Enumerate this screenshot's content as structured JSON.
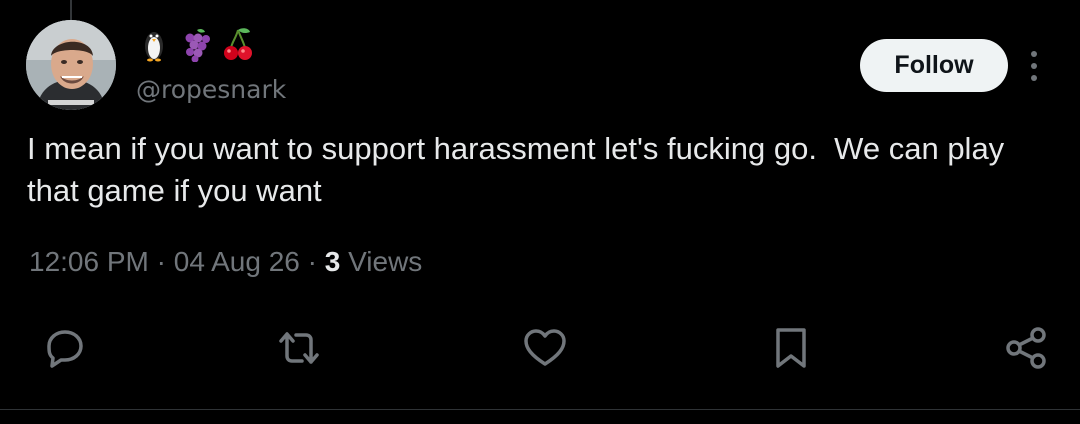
{
  "author": {
    "handle": "@ropesnark",
    "display_name_emojis": [
      "penguin-emoji",
      "grapes-emoji",
      "cherries-emoji"
    ],
    "avatar": "profile-photo"
  },
  "header": {
    "follow_label": "Follow",
    "more_icon": "more-vertical-icon"
  },
  "tweet": {
    "text": "I mean if you want to support harassment let's fucking go.  We can play that game if you want",
    "time": "12:06 PM",
    "separator": "·",
    "date": "04 Aug 26",
    "views_count": "3",
    "views_label": "Views"
  },
  "actions": [
    {
      "name": "reply",
      "icon": "reply-icon"
    },
    {
      "name": "repost",
      "icon": "repost-icon"
    },
    {
      "name": "like",
      "icon": "heart-icon"
    },
    {
      "name": "bookmark",
      "icon": "bookmark-icon"
    },
    {
      "name": "share",
      "icon": "share-icon"
    }
  ],
  "colors": {
    "background": "#000000",
    "text_primary": "#e7e9ea",
    "text_secondary": "#71767b",
    "follow_bg": "#eff3f4",
    "follow_text": "#0f1419"
  }
}
